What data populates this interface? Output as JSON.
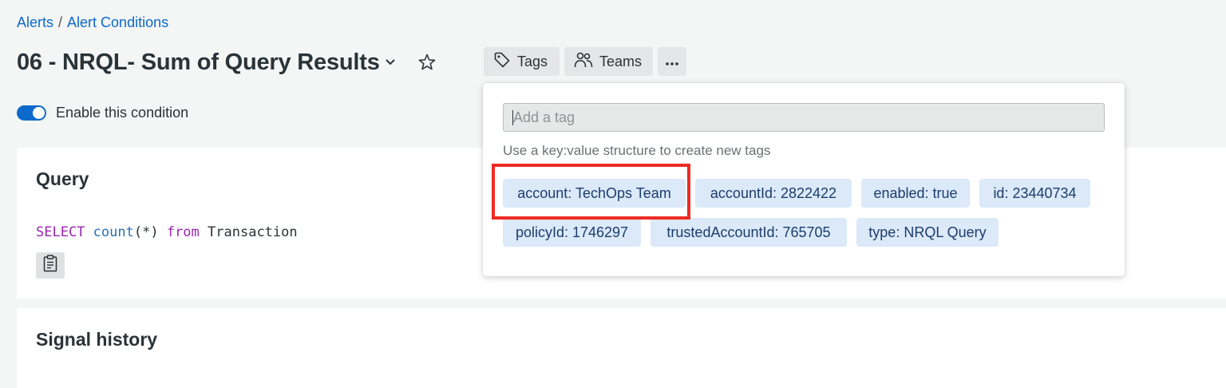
{
  "breadcrumb": {
    "items": [
      "Alerts",
      "Alert Conditions"
    ],
    "separator": "/"
  },
  "header": {
    "title": "06 - NRQL- Sum of Query Results",
    "tags_label": "Tags",
    "teams_label": "Teams",
    "more_label": "···"
  },
  "toggle": {
    "label": "Enable this condition",
    "enabled": true
  },
  "query_card": {
    "title": "Query",
    "code": {
      "kw_select": "SELECT",
      "fn_count": "count",
      "arg": "(*)",
      "kw_from": "from",
      "table": "Transaction"
    }
  },
  "signal_card": {
    "title": "Signal history"
  },
  "tag_popover": {
    "input_placeholder": "Add a tag",
    "help_text": "Use a key:value structure to create new tags",
    "tags": [
      "account: TechOps Team",
      "accountId: 2822422",
      "enabled: true",
      "id: 23440734",
      "policyId: 1746297",
      "trustedAccountId: 765705",
      "type: NRQL Query"
    ]
  },
  "colors": {
    "accent": "#0b6acb",
    "chip_bg": "#dbe9f9",
    "highlight": "#ee2b25"
  }
}
